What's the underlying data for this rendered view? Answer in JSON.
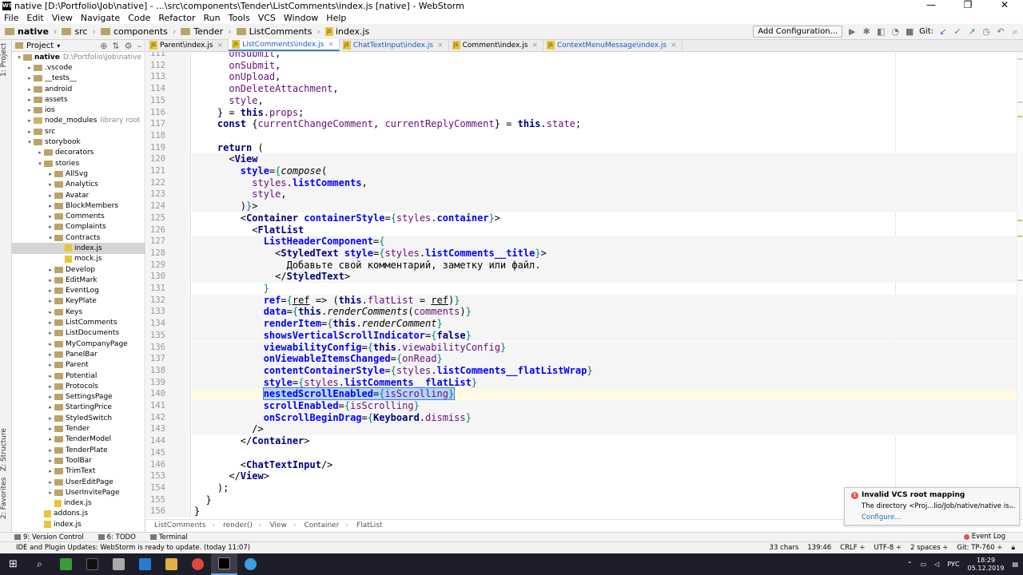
{
  "window": {
    "title": "native [D:\\Portfolio\\Job\\native] - ...\\src\\components\\Tender\\ListComments\\index.js [native] - WebStorm",
    "min": "—",
    "max": "❐",
    "close": "✕"
  },
  "menu": [
    "File",
    "Edit",
    "View",
    "Navigate",
    "Code",
    "Refactor",
    "Run",
    "Tools",
    "VCS",
    "Window",
    "Help"
  ],
  "breadcrumbs": [
    "native",
    "src",
    "components",
    "Tender",
    "ListComments",
    "index.js"
  ],
  "toolbar": {
    "add_config": "Add Configuration...",
    "git_label": "Git:"
  },
  "left_strip": {
    "project": "1: Project",
    "structure": "Z: Structure",
    "favorites": "2: Favorites"
  },
  "project_panel": {
    "title": "Project",
    "tree": [
      {
        "label": "native",
        "extra": "D:\\Portfolio\\Job\\native",
        "depth": 0,
        "arrow": "▾",
        "kind": "folder",
        "bold": true
      },
      {
        "label": ".vscode",
        "depth": 1,
        "arrow": "▸",
        "kind": "folder"
      },
      {
        "label": "__tests__",
        "depth": 1,
        "arrow": "▸",
        "kind": "folder"
      },
      {
        "label": "android",
        "depth": 1,
        "arrow": "▸",
        "kind": "folder"
      },
      {
        "label": "assets",
        "depth": 1,
        "arrow": "▸",
        "kind": "folder"
      },
      {
        "label": "ios",
        "depth": 1,
        "arrow": "▸",
        "kind": "folder"
      },
      {
        "label": "node_modules",
        "extra": "library root",
        "depth": 1,
        "arrow": "▸",
        "kind": "folder",
        "nm": true
      },
      {
        "label": "src",
        "depth": 1,
        "arrow": "▸",
        "kind": "folder"
      },
      {
        "label": "storybook",
        "depth": 1,
        "arrow": "▾",
        "kind": "folder"
      },
      {
        "label": "decorators",
        "depth": 2,
        "arrow": "▸",
        "kind": "folder"
      },
      {
        "label": "stories",
        "depth": 2,
        "arrow": "▾",
        "kind": "folder"
      },
      {
        "label": "AllSvg",
        "depth": 3,
        "arrow": "▸",
        "kind": "folder"
      },
      {
        "label": "Analytics",
        "depth": 3,
        "arrow": "▸",
        "kind": "folder"
      },
      {
        "label": "Avatar",
        "depth": 3,
        "arrow": "▸",
        "kind": "folder"
      },
      {
        "label": "BlockMembers",
        "depth": 3,
        "arrow": "▸",
        "kind": "folder"
      },
      {
        "label": "Comments",
        "depth": 3,
        "arrow": "▸",
        "kind": "folder"
      },
      {
        "label": "Complaints",
        "depth": 3,
        "arrow": "▸",
        "kind": "folder"
      },
      {
        "label": "Contracts",
        "depth": 3,
        "arrow": "▾",
        "kind": "folder"
      },
      {
        "label": "index.js",
        "depth": 4,
        "arrow": "",
        "kind": "js",
        "selected": true
      },
      {
        "label": "mock.js",
        "depth": 4,
        "arrow": "",
        "kind": "js"
      },
      {
        "label": "Develop",
        "depth": 3,
        "arrow": "▸",
        "kind": "folder"
      },
      {
        "label": "EditMark",
        "depth": 3,
        "arrow": "▸",
        "kind": "folder"
      },
      {
        "label": "EventLog",
        "depth": 3,
        "arrow": "▸",
        "kind": "folder"
      },
      {
        "label": "KeyPlate",
        "depth": 3,
        "arrow": "▸",
        "kind": "folder"
      },
      {
        "label": "Keys",
        "depth": 3,
        "arrow": "▸",
        "kind": "folder"
      },
      {
        "label": "ListComments",
        "depth": 3,
        "arrow": "▸",
        "kind": "folder"
      },
      {
        "label": "ListDocuments",
        "depth": 3,
        "arrow": "▸",
        "kind": "folder"
      },
      {
        "label": "MyCompanyPage",
        "depth": 3,
        "arrow": "▸",
        "kind": "folder"
      },
      {
        "label": "PanelBar",
        "depth": 3,
        "arrow": "▸",
        "kind": "folder"
      },
      {
        "label": "Parent",
        "depth": 3,
        "arrow": "▸",
        "kind": "folder"
      },
      {
        "label": "Potential",
        "depth": 3,
        "arrow": "▸",
        "kind": "folder"
      },
      {
        "label": "Protocols",
        "depth": 3,
        "arrow": "▸",
        "kind": "folder"
      },
      {
        "label": "SettingsPage",
        "depth": 3,
        "arrow": "▸",
        "kind": "folder"
      },
      {
        "label": "StartingPrice",
        "depth": 3,
        "arrow": "▸",
        "kind": "folder"
      },
      {
        "label": "StyledSwitch",
        "depth": 3,
        "arrow": "▸",
        "kind": "folder"
      },
      {
        "label": "Tender",
        "depth": 3,
        "arrow": "▸",
        "kind": "folder"
      },
      {
        "label": "TenderModel",
        "depth": 3,
        "arrow": "▸",
        "kind": "folder"
      },
      {
        "label": "TenderPlate",
        "depth": 3,
        "arrow": "▸",
        "kind": "folder"
      },
      {
        "label": "ToolBar",
        "depth": 3,
        "arrow": "▸",
        "kind": "folder"
      },
      {
        "label": "TrimText",
        "depth": 3,
        "arrow": "▸",
        "kind": "folder"
      },
      {
        "label": "UserEditPage",
        "depth": 3,
        "arrow": "▸",
        "kind": "folder"
      },
      {
        "label": "UserInvitePage",
        "depth": 3,
        "arrow": "▸",
        "kind": "folder"
      },
      {
        "label": "index.js",
        "depth": 3,
        "arrow": "",
        "kind": "js"
      },
      {
        "label": "addons.js",
        "depth": 2,
        "arrow": "",
        "kind": "js"
      },
      {
        "label": "index.js",
        "depth": 2,
        "arrow": "",
        "kind": "js"
      }
    ]
  },
  "tabs": [
    {
      "label": "Parent\\index.js",
      "active": false,
      "blue": false
    },
    {
      "label": "ListComments\\index.js",
      "active": true,
      "blue": true
    },
    {
      "label": "ChatTextInput\\index.js",
      "active": false,
      "blue": true
    },
    {
      "label": "Comment\\index.js",
      "active": false,
      "blue": false
    },
    {
      "label": "ContextMenuMessage\\index.js",
      "active": false,
      "blue": true
    }
  ],
  "code": [
    {
      "n": "111",
      "html": "      <span class=\"pl\">onSubmit</span>,"
    },
    {
      "n": "112",
      "html": "      <span class=\"pl\">onSubmit</span>,"
    },
    {
      "n": "113",
      "html": "      <span class=\"pl\">onUpload</span>,"
    },
    {
      "n": "114",
      "html": "      <span class=\"pl\">onDeleteAttachment</span>,"
    },
    {
      "n": "115",
      "html": "      <span class=\"pl\">style</span>,"
    },
    {
      "n": "116",
      "html": "    } = <span class=\"kw\">this</span>.<span class=\"prop\">props</span>;"
    },
    {
      "n": "117",
      "html": "    <span class=\"kw\">const</span> {<span class=\"pl\">currentChangeComment</span>, <span class=\"pl\">currentReplyComment</span>} = <span class=\"kw\">this</span>.<span class=\"prop\">state</span>;"
    },
    {
      "n": "118",
      "html": ""
    },
    {
      "n": "119",
      "html": "    <span class=\"kw\">return</span> ("
    },
    {
      "n": "120",
      "html": "      &lt;<span class=\"tag\">View</span>",
      "bg": "hl"
    },
    {
      "n": "121",
      "html": "        <span class=\"attr\">style</span>=<span class=\"brace\">{</span><span class=\"fn\">compose</span>(",
      "bg": "hl"
    },
    {
      "n": "122",
      "html": "          <span class=\"pl\">styles</span>.<span class=\"attr\">listComments</span>,",
      "bg": "hl"
    },
    {
      "n": "123",
      "html": "          <span class=\"pl\">style</span>,",
      "bg": "hl"
    },
    {
      "n": "124",
      "html": "        )<span class=\"brace\">}</span>&gt;",
      "bg": "hl"
    },
    {
      "n": "125",
      "html": "        &lt;<span class=\"tag\">Container</span> <span class=\"attr\">containerStyle</span>=<span class=\"brace\">{</span><span class=\"pl\">styles</span>.<span class=\"attr\">container</span><span class=\"brace\">}</span>&gt;"
    },
    {
      "n": "126",
      "html": "          &lt;<span class=\"tag\">FlatList</span>"
    },
    {
      "n": "127",
      "html": "            <span class=\"attr\">ListHeaderComponent</span>=<span class=\"brace\">{</span>",
      "bg": "hl"
    },
    {
      "n": "128",
      "html": "              &lt;<span class=\"tag\">StyledText</span> <span class=\"attr\">style</span>=<span class=\"brace\">{</span><span class=\"pl\">styles</span>.<span class=\"attr\">listComments__title</span><span class=\"brace\">}</span>&gt;",
      "bg": "hl"
    },
    {
      "n": "129",
      "html": "                Добавьте свой комментарий, заметку или файл.",
      "bg": "hl"
    },
    {
      "n": "130",
      "html": "              &lt;/<span class=\"tag\">StyledText</span>&gt;",
      "bg": "hl"
    },
    {
      "n": "131",
      "html": "            <span class=\"brace\">}</span>"
    },
    {
      "n": "132",
      "html": "            <span class=\"attr\">ref</span>=<span class=\"brace\">{</span><u>ref</u> =&gt; (<span class=\"kw\">this</span>.<span class=\"prop\">flatList</span> = <u>ref</u>)<span class=\"brace\">}</span>",
      "bg": "hl"
    },
    {
      "n": "133",
      "html": "            <span class=\"attr\">data</span>=<span class=\"brace\">{</span><span class=\"kw\">this</span>.<span class=\"fn\">renderComments</span>(<span class=\"pl\">comments</span>)<span class=\"brace\">}</span>",
      "bg": "hl"
    },
    {
      "n": "134",
      "html": "            <span class=\"attr\">renderItem</span>=<span class=\"brace\">{</span><span class=\"kw\">this</span>.<span class=\"fn\">renderComment</span><span class=\"brace\">}</span>",
      "bg": "hl"
    },
    {
      "n": "135",
      "html": "            <span class=\"attr\">showsVerticalScrollIndicator</span>=<span class=\"brace\">{</span><span class=\"kw\">false</span><span class=\"brace\">}</span>",
      "bg": "hl"
    },
    {
      "n": "136",
      "html": "            <span class=\"attr\">viewabilityConfig</span>=<span class=\"brace\">{</span><span class=\"kw\">this</span>.<span class=\"prop\">viewabilityConfig</span><span class=\"brace\">}</span>",
      "bg": "hl"
    },
    {
      "n": "137",
      "html": "            <span class=\"attr\">onViewableItemsChanged</span>=<span class=\"brace\">{</span><span class=\"pl\">onRead</span><span class=\"brace\">}</span>",
      "bg": "hl"
    },
    {
      "n": "138",
      "html": "            <span class=\"attr\">contentContainerStyle</span>=<span class=\"brace\">{</span><span class=\"pl\">styles</span>.<span class=\"attr\">listComments__flatListWrap</span><span class=\"brace\">}</span>",
      "bg": "hl"
    },
    {
      "n": "139",
      "html": "            <span class=\"attr\">style</span>=<span class=\"brace\">{</span><span class=\"pl\">styles</span>.<span class=\"attr\">listComments__flatList</span><span class=\"brace\">}</span>",
      "bg": "hl"
    },
    {
      "n": "140",
      "html": "            <span class=\"sel-txt\"><span class=\"attr\">nestedScrollEnabled</span>=<span class=\"brace\">{</span><span class=\"pl\">isScrolling</span><span class=\"brace\">}</span></span>",
      "bg": "cur"
    },
    {
      "n": "141",
      "html": "            <span class=\"attr\">scrollEnabled</span>=<span class=\"brace\">{</span><span class=\"pl\">isScrolling</span><span class=\"brace\">}</span>",
      "bg": "hl"
    },
    {
      "n": "142",
      "html": "            <span class=\"attr\">onScrollBeginDrag</span>=<span class=\"brace\">{</span><span class=\"tag\">Keyboard</span>.<span class=\"pl\">dismiss</span><span class=\"brace\">}</span>",
      "bg": "hl"
    },
    {
      "n": "143",
      "html": "          /&gt;",
      "bg": "hl"
    },
    {
      "n": "144",
      "html": "        &lt;/<span class=\"tag\">Container</span>&gt;"
    },
    {
      "n": "145",
      "html": ""
    },
    {
      "n": "146",
      "html": "        &lt;<span class=\"tag\">ChatTextInput</span>/&gt;"
    },
    {
      "n": "153",
      "html": "      &lt;/<span class=\"tag\">View</span>&gt;"
    },
    {
      "n": "154",
      "html": "    );"
    },
    {
      "n": "155",
      "html": "  }"
    },
    {
      "n": "156",
      "html": "}"
    },
    {
      "n": "157",
      "html": ""
    }
  ],
  "code_crumbs": [
    "ListComments",
    "render()",
    "View",
    "Container",
    "FlatList"
  ],
  "notification": {
    "title": "Invalid VCS root mapping",
    "body": "The directory <Proj...lio/Job/native/native is...",
    "link": "Configure..."
  },
  "bottom_tabs": [
    "9: Version Control",
    "6: TODO",
    "Terminal"
  ],
  "event_log": "Event Log",
  "status": {
    "message": "IDE and Plugin Updates: WebStorm is ready to update. (today 11:07)",
    "chars": "33 chars",
    "position": "139:46",
    "line_sep": "CRLF ÷",
    "encoding": "UTF-8 ÷",
    "indent": "2 spaces ÷",
    "git": "Git: TP-760 ÷"
  },
  "taskbar": {
    "lang": "РУС",
    "time": "18:29",
    "date": "05.12.2019"
  }
}
